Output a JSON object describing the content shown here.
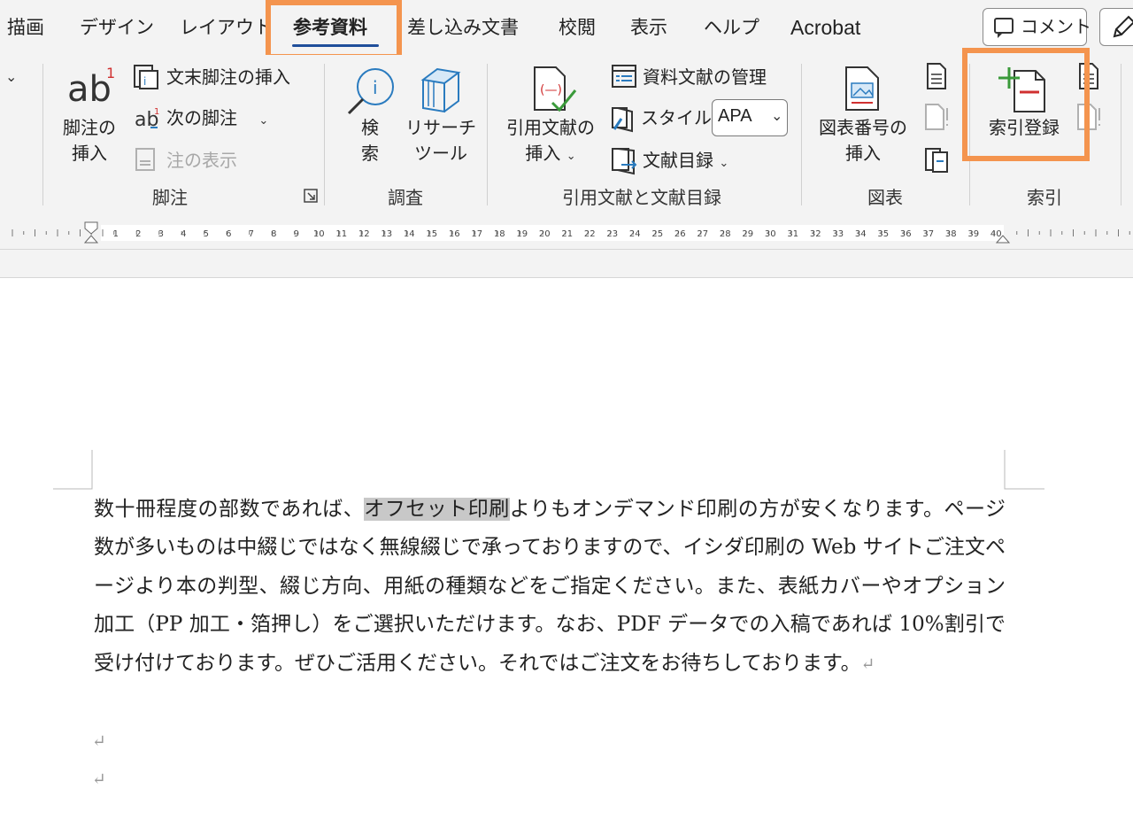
{
  "tabs": [
    {
      "label": "描画"
    },
    {
      "label": "デザイン"
    },
    {
      "label": "レイアウト"
    },
    {
      "label": "参考資料"
    },
    {
      "label": "差し込み文書"
    },
    {
      "label": "校閲"
    },
    {
      "label": "表示"
    },
    {
      "label": "ヘルプ"
    },
    {
      "label": "Acrobat"
    }
  ],
  "active_tab": "参考資料",
  "comment_button": {
    "label": "コメント"
  },
  "ribbon": {
    "footnote_group": {
      "label": "脚注",
      "insert_footnote": {
        "label_line1": "脚注の",
        "label_line2": "挿入"
      },
      "insert_endnote": {
        "label": "文末脚注の挿入"
      },
      "next_footnote": {
        "label": "次の脚注"
      },
      "show_notes": {
        "label": "注の表示"
      }
    },
    "research_group": {
      "label": "調査",
      "search": {
        "label_line1": "検",
        "label_line2": "索"
      },
      "researcher": {
        "label_line1": "リサーチ",
        "label_line2": "ツール"
      }
    },
    "citations_group": {
      "label": "引用文献と文献目録",
      "insert_citation": {
        "label_line1": "引用文献の",
        "label_line2": "挿入"
      },
      "manage_sources": {
        "label": "資料文献の管理"
      },
      "style": {
        "label": "スタイル:",
        "value": "APA"
      },
      "bibliography": {
        "label": "文献目録"
      }
    },
    "captions_group": {
      "label": "図表",
      "insert_caption": {
        "label_line1": "図表番号の",
        "label_line2": "挿入"
      }
    },
    "index_group": {
      "label": "索引",
      "mark_entry": {
        "label": "索引登録"
      }
    }
  },
  "ruler_numbers": [
    "1",
    "2",
    "3",
    "4",
    "5",
    "6",
    "7",
    "8",
    "9",
    "10",
    "11",
    "12",
    "13",
    "14",
    "15",
    "16",
    "17",
    "18",
    "19",
    "20",
    "21",
    "22",
    "23",
    "24",
    "25",
    "26",
    "27",
    "28",
    "29",
    "30",
    "31",
    "32",
    "33",
    "34",
    "35",
    "36",
    "37",
    "38",
    "39",
    "40"
  ],
  "document": {
    "text_before_selection": "数十冊程度の部数であれば、",
    "selected_text": "オフセット印刷",
    "text_after_selection": "よりもオンデマンド印刷の方が安くなります。ページ数が多いものは中綴じではなく無線綴じで承っておりますので、イシダ印刷の Web サイトご注文ページより本の判型、綴じ方向、用紙の種類などをご指定ください。また、表紙カバーやオプション加工（PP 加工・箔押し）をご選択いただけます。なお、PDF データでの入稿であれば 10%割引で受け付けております。ぜひご活用ください。それではご注文をお待ちしております。",
    "paragraph_mark": "↵"
  },
  "colors": {
    "highlight_box": "#f4944e",
    "active_tab_underline": "#1f4e9a",
    "selection": "#c8c8c8"
  }
}
